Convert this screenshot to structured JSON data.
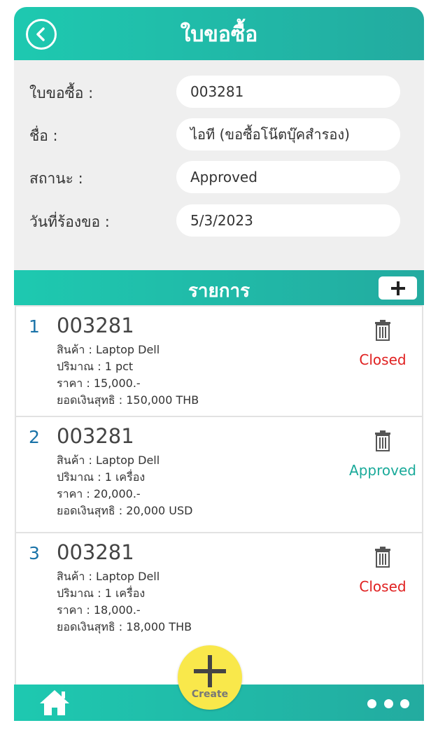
{
  "header": {
    "title": "ใบขอซื้อ"
  },
  "form": {
    "rows": [
      {
        "label": "ใบขอซื้อ :",
        "value": "003281"
      },
      {
        "label": "ชื่อ :",
        "value": "ไอที (ขอซื้อโน๊ตบุ๊คสำรอง)"
      },
      {
        "label": "สถานะ :",
        "value": "Approved"
      },
      {
        "label": "วันที่ร้องขอ :",
        "value": "5/3/2023"
      }
    ]
  },
  "items_section": {
    "title": "รายการ"
  },
  "items": [
    {
      "index": "1",
      "code": "003281",
      "product": "สินค้า : Laptop Dell",
      "quantity": "ปริมาณ : 1 pct",
      "price": "ราคา : 15,000.-",
      "net": "ยอดเงินสุทธิ : 150,000 THB",
      "status": "Closed",
      "status_color": "#e02020"
    },
    {
      "index": "2",
      "code": "003281",
      "product": "สินค้า : Laptop Dell",
      "quantity": "ปริมาณ : 1 เครื่อง",
      "price": "ราคา : 20,000.-",
      "net": "ยอดเงินสุทธิ : 20,000 USD",
      "status": "Approved",
      "status_color": "#1aaa9a"
    },
    {
      "index": "3",
      "code": "003281",
      "product": "สินค้า : Laptop Dell",
      "quantity": "ปริมาณ : 1 เครื่อง",
      "price": "ราคา : 18,000.-",
      "net": "ยอดเงินสุทธิ : 18,000 THB",
      "status": "Closed",
      "status_color": "#e02020"
    }
  ],
  "bottom_bar": {
    "create_label": "Create"
  },
  "colors": {
    "accent": "#1ec9b0",
    "accent_dark": "#23aba0",
    "fab": "#f9e84b",
    "closed": "#e02020",
    "approved": "#1aaa9a",
    "index": "#1a73a8"
  },
  "icons": [
    "back-icon",
    "plus-icon",
    "trash-icon",
    "home-icon",
    "more-icon"
  ]
}
